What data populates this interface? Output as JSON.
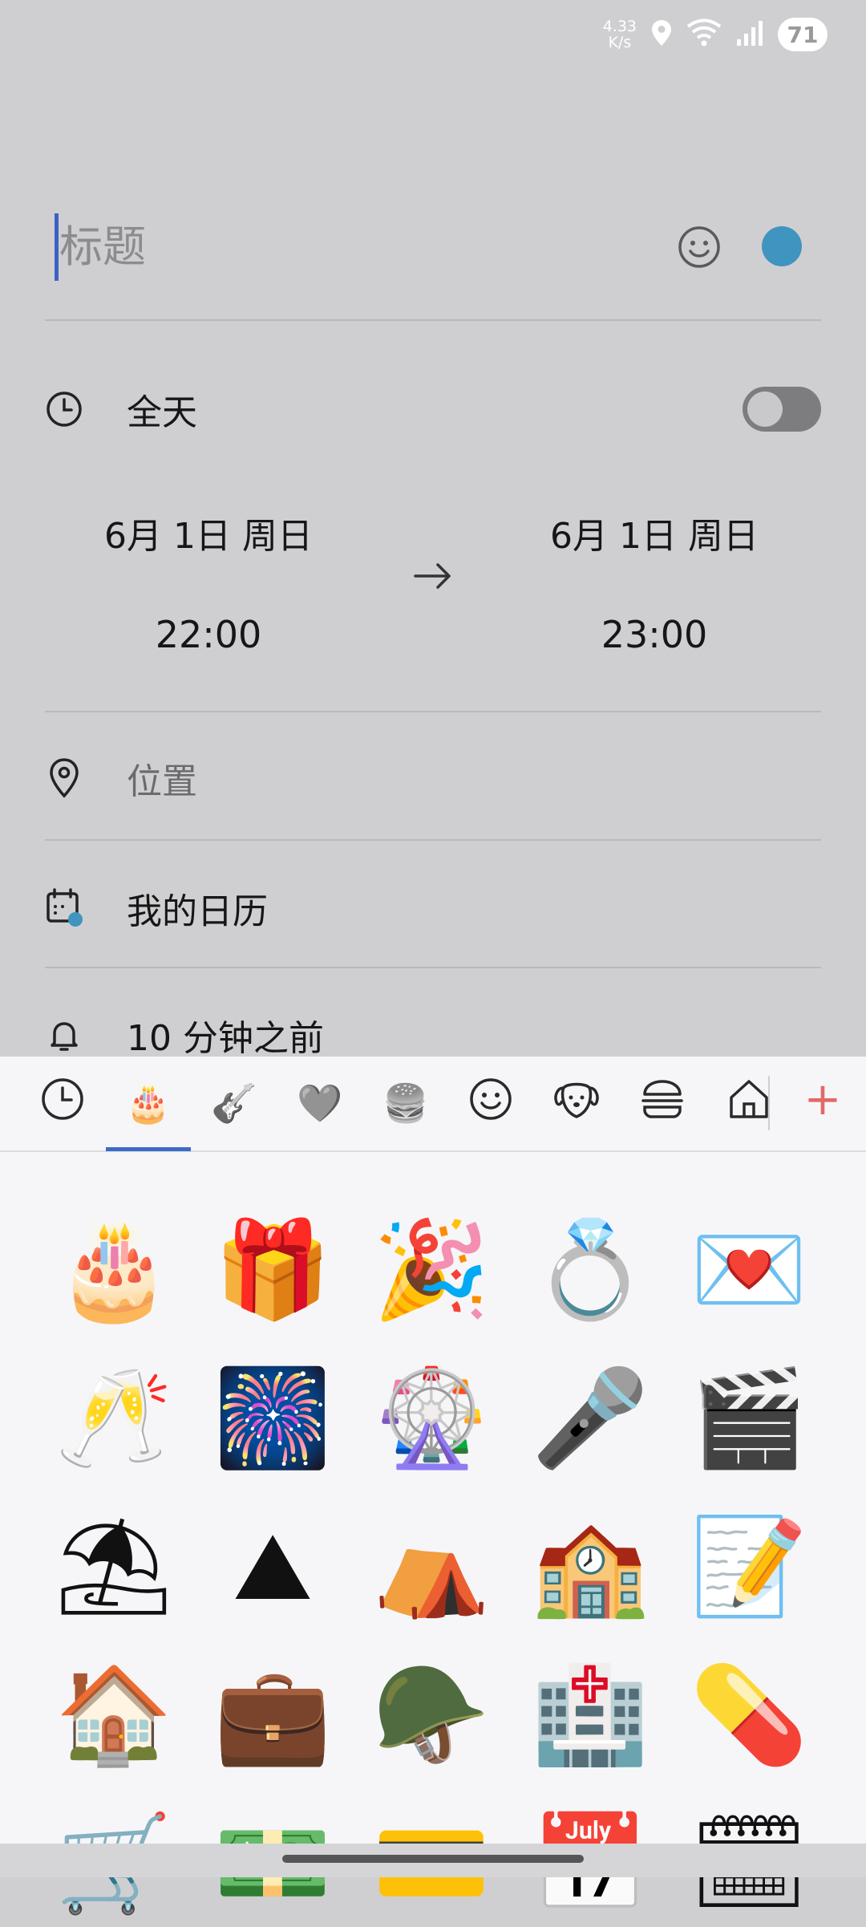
{
  "status_bar": {
    "speed_value": "4.33",
    "speed_unit": "K/s",
    "battery": "71",
    "icons": [
      "location-icon",
      "wifi-icon",
      "signal-icon"
    ]
  },
  "event": {
    "title_placeholder": "标题",
    "color": "#3f95bf",
    "all_day_label": "全天",
    "all_day_on": false,
    "start_date": "6月 1日 周日",
    "start_time": "22:00",
    "end_date": "6月 1日 周日",
    "end_time": "23:00",
    "location_placeholder": "位置",
    "calendar_label": "我的日历",
    "reminder_label": "10 分钟之前"
  },
  "emoji_panel": {
    "categories": [
      {
        "name": "recent",
        "glyph": "🕒"
      },
      {
        "name": "celebration",
        "glyph": "🎂"
      },
      {
        "name": "music",
        "glyph": "🎸"
      },
      {
        "name": "heart",
        "glyph": "🩶"
      },
      {
        "name": "food",
        "glyph": "🍔"
      },
      {
        "name": "smiley",
        "glyph": "☺"
      },
      {
        "name": "animal",
        "glyph": "🐶"
      },
      {
        "name": "burger-outline",
        "glyph": "🍔"
      },
      {
        "name": "home",
        "glyph": "⌂"
      }
    ],
    "add_label": "+",
    "emojis": [
      "🎂",
      "🎁",
      "🎉",
      "💍",
      "💌",
      "🥂",
      "🎆",
      "🎡",
      "🎤",
      "🎬",
      "⛱",
      "⛰",
      "⛺",
      "🏫",
      "📝",
      "🏠",
      "💼",
      "🪖",
      "🏥",
      "💊",
      "🛒",
      "💵",
      "💳",
      "📅",
      "🗓"
    ]
  }
}
